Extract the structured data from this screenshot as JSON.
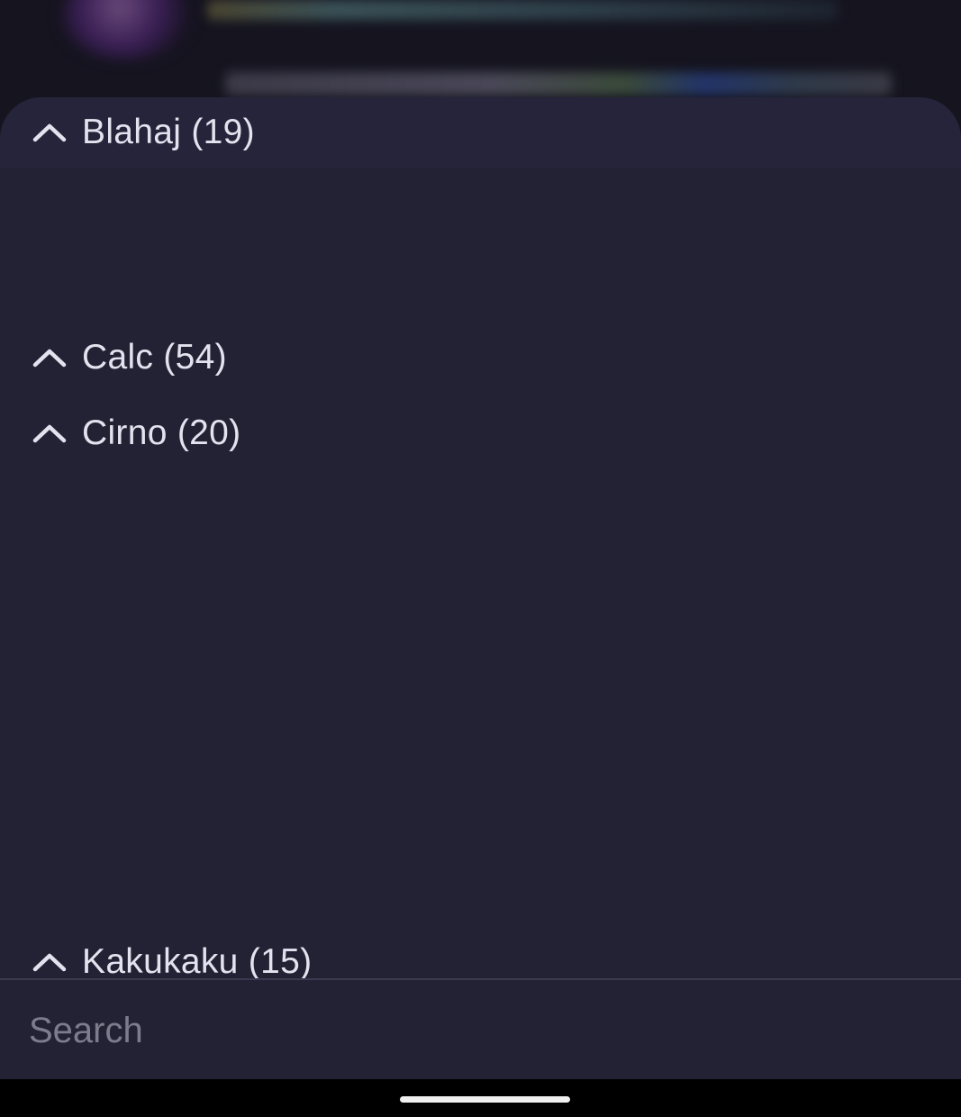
{
  "groups": [
    {
      "label": "Blahaj (19)",
      "icon": "chevron-up-icon",
      "expanded": true
    },
    {
      "label": "Calc (54)",
      "icon": "chevron-up-icon",
      "expanded": true
    },
    {
      "label": "Cirno (20)",
      "icon": "chevron-up-icon",
      "expanded": true
    },
    {
      "label": "Kakukaku (15)",
      "icon": "chevron-up-icon",
      "expanded": true
    }
  ],
  "search": {
    "placeholder": "Search",
    "value": ""
  },
  "colors": {
    "sheet_background": "#232234",
    "text": "#e4e2ee",
    "placeholder": "#7e7c8c"
  }
}
